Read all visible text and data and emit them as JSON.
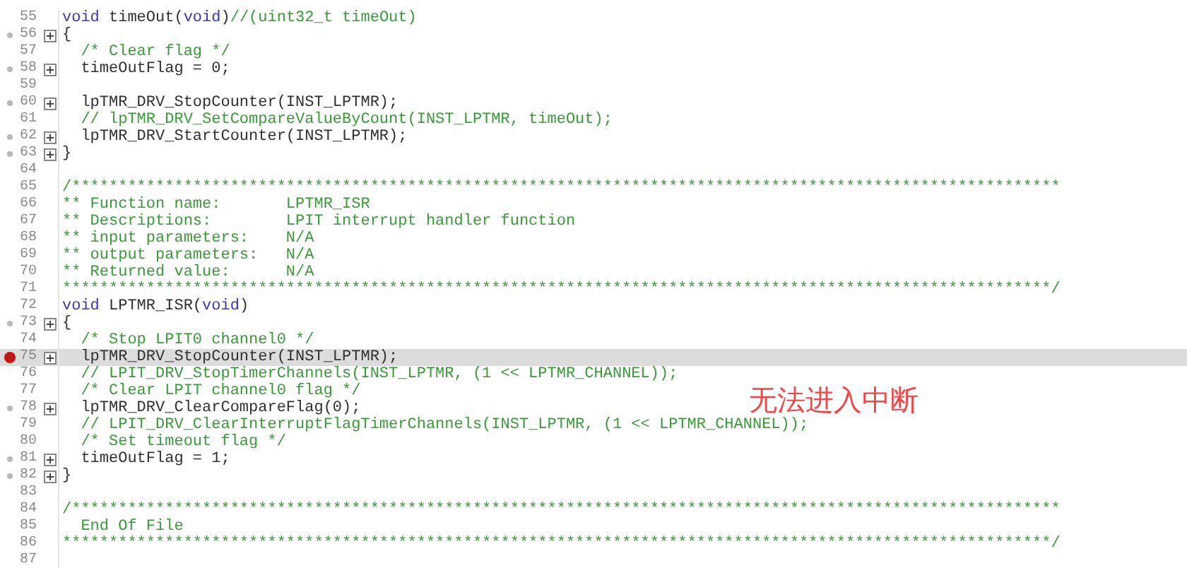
{
  "editor": {
    "lines": [
      {
        "number": "55",
        "tokens": [
          {
            "kind": "keyword",
            "text": "void"
          },
          {
            "kind": "code",
            "text": " timeOut("
          },
          {
            "kind": "keyword",
            "text": "void"
          },
          {
            "kind": "code",
            "text": ")"
          },
          {
            "kind": "comment",
            "text": "//(uint32_t timeOut)"
          }
        ]
      },
      {
        "number": "56",
        "marked": true,
        "fold": true,
        "tokens": [
          {
            "kind": "code",
            "text": "{"
          }
        ]
      },
      {
        "number": "57",
        "tokens": [
          {
            "kind": "comment",
            "text": "  /* Clear flag */"
          }
        ]
      },
      {
        "number": "58",
        "marked": true,
        "fold": true,
        "tokens": [
          {
            "kind": "code",
            "text": "  timeOutFlag = 0;"
          }
        ]
      },
      {
        "number": "59"
      },
      {
        "number": "60",
        "marked": true,
        "fold": true,
        "tokens": [
          {
            "kind": "code",
            "text": "  lpTMR_DRV_StopCounter(INST_LPTMR);"
          }
        ]
      },
      {
        "number": "61",
        "tokens": [
          {
            "kind": "comment",
            "text": "  // lpTMR_DRV_SetCompareValueByCount(INST_LPTMR, timeOut);"
          }
        ]
      },
      {
        "number": "62",
        "marked": true,
        "fold": true,
        "tokens": [
          {
            "kind": "code",
            "text": "  lpTMR_DRV_StartCounter(INST_LPTMR);"
          }
        ]
      },
      {
        "number": "63",
        "marked": true,
        "fold": true,
        "tokens": [
          {
            "kind": "code",
            "text": "}"
          }
        ]
      },
      {
        "number": "64"
      },
      {
        "number": "65",
        "tokens": [
          {
            "kind": "comment",
            "text": "/**********************************************************************************************************"
          }
        ]
      },
      {
        "number": "66",
        "tokens": [
          {
            "kind": "comment",
            "text": "** Function name:       LPTMR_ISR"
          }
        ]
      },
      {
        "number": "67",
        "tokens": [
          {
            "kind": "comment",
            "text": "** Descriptions:        LPIT interrupt handler function"
          }
        ]
      },
      {
        "number": "68",
        "tokens": [
          {
            "kind": "comment",
            "text": "** input parameters:    N/A"
          }
        ]
      },
      {
        "number": "69",
        "tokens": [
          {
            "kind": "comment",
            "text": "** output parameters:   N/A"
          }
        ]
      },
      {
        "number": "70",
        "tokens": [
          {
            "kind": "comment",
            "text": "** Returned value:      N/A"
          }
        ]
      },
      {
        "number": "71",
        "tokens": [
          {
            "kind": "comment",
            "text": "**********************************************************************************************************/"
          }
        ]
      },
      {
        "number": "72",
        "tokens": [
          {
            "kind": "keyword",
            "text": "void"
          },
          {
            "kind": "code",
            "text": " LPTMR_ISR("
          },
          {
            "kind": "keyword",
            "text": "void"
          },
          {
            "kind": "code",
            "text": ")"
          }
        ]
      },
      {
        "number": "73",
        "marked": true,
        "fold": true,
        "tokens": [
          {
            "kind": "code",
            "text": "{"
          }
        ]
      },
      {
        "number": "74",
        "tokens": [
          {
            "kind": "comment",
            "text": "  /* Stop LPIT0 channel0 */"
          }
        ]
      },
      {
        "number": "75",
        "breakpoint": true,
        "fold": true,
        "highlighted": true,
        "tokens": [
          {
            "kind": "code",
            "text": "  lpTMR_DRV_StopCounter(INST_LPTMR);"
          }
        ]
      },
      {
        "number": "76",
        "tokens": [
          {
            "kind": "comment",
            "text": "  // LPIT_DRV_StopTimerChannels(INST_LPTMR, (1 << LPTMR_CHANNEL));"
          }
        ]
      },
      {
        "number": "77",
        "tokens": [
          {
            "kind": "comment",
            "text": "  /* Clear LPIT channel0 flag */"
          }
        ]
      },
      {
        "number": "78",
        "marked": true,
        "fold": true,
        "tokens": [
          {
            "kind": "code",
            "text": "  lpTMR_DRV_ClearCompareFlag(0);"
          }
        ]
      },
      {
        "number": "79",
        "tokens": [
          {
            "kind": "comment",
            "text": "  // LPIT_DRV_ClearInterruptFlagTimerChannels(INST_LPTMR, (1 << LPTMR_CHANNEL));"
          }
        ]
      },
      {
        "number": "80",
        "tokens": [
          {
            "kind": "comment",
            "text": "  /* Set timeout flag */"
          }
        ]
      },
      {
        "number": "81",
        "marked": true,
        "fold": true,
        "tokens": [
          {
            "kind": "code",
            "text": "  timeOutFlag = 1;"
          }
        ]
      },
      {
        "number": "82",
        "marked": true,
        "fold": true,
        "tokens": [
          {
            "kind": "code",
            "text": "}"
          }
        ]
      },
      {
        "number": "83"
      },
      {
        "number": "84",
        "tokens": [
          {
            "kind": "comment",
            "text": "/**********************************************************************************************************"
          }
        ]
      },
      {
        "number": "85",
        "tokens": [
          {
            "kind": "comment",
            "text": "  End Of File"
          }
        ]
      },
      {
        "number": "86",
        "tokens": [
          {
            "kind": "comment",
            "text": "**********************************************************************************************************/"
          }
        ]
      },
      {
        "number": "87"
      }
    ]
  },
  "annotation": {
    "text": "无法进入中断"
  }
}
